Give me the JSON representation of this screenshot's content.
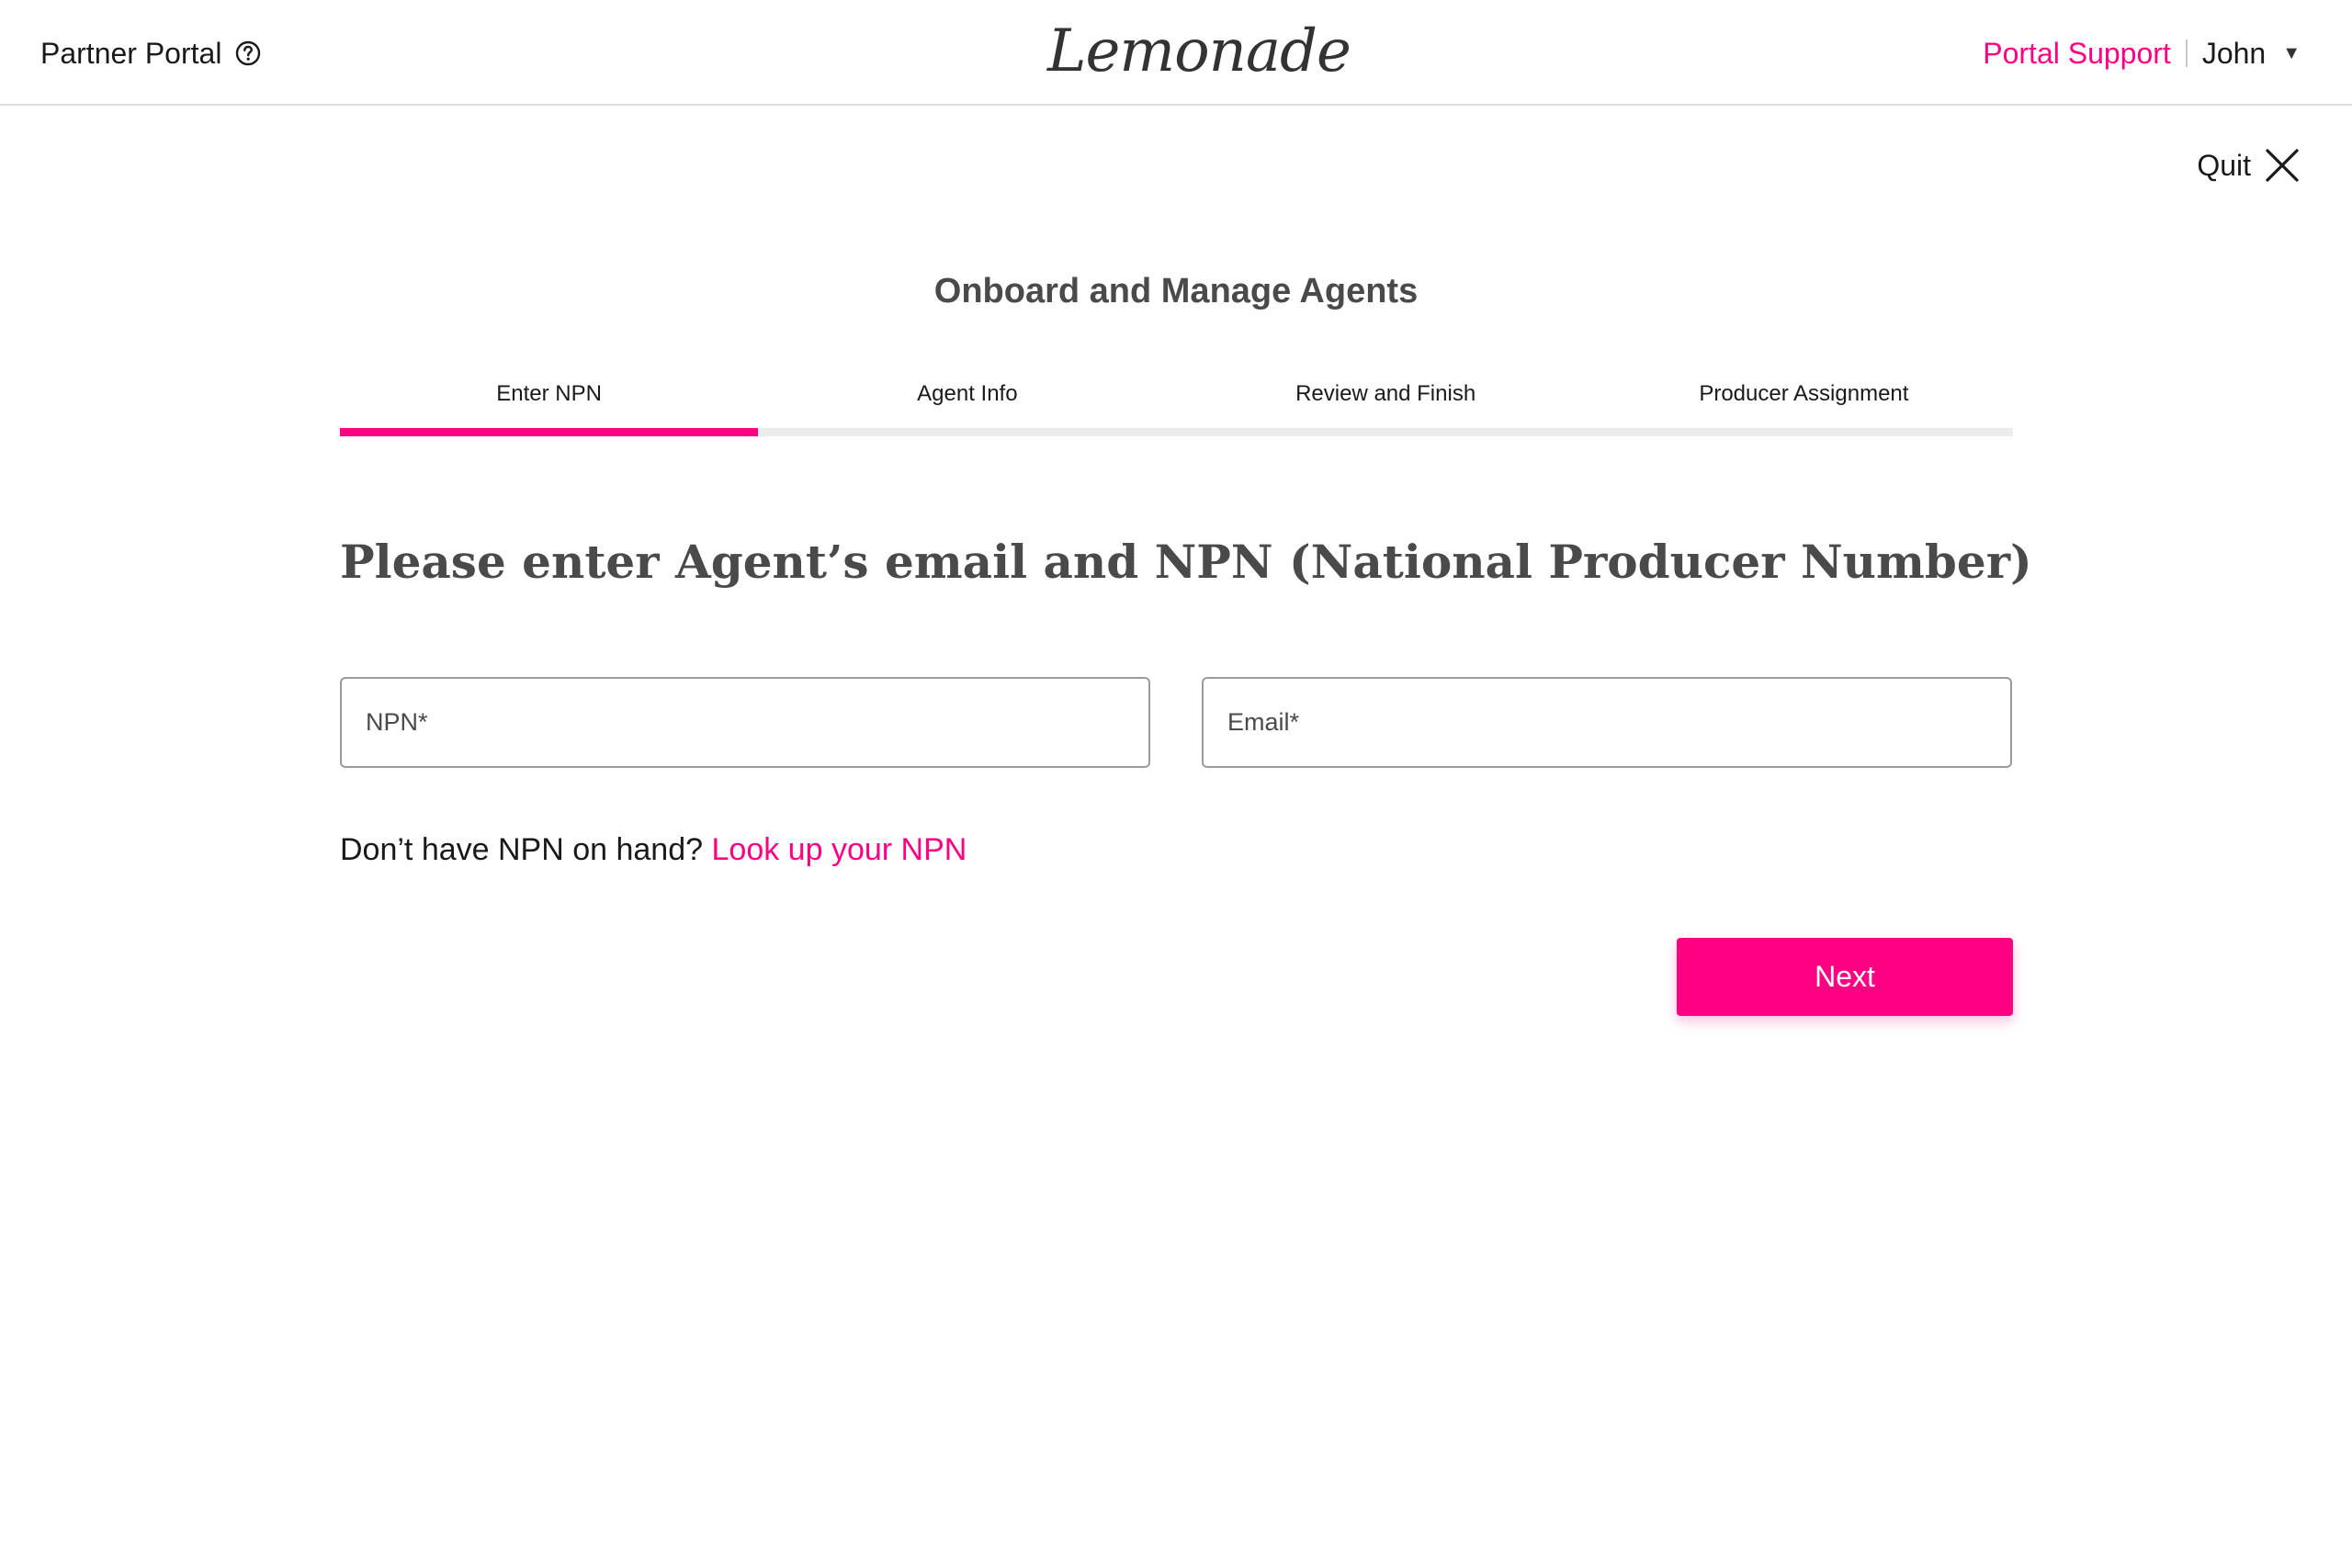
{
  "header": {
    "portal_title": "Partner Portal",
    "help_icon": "question-circle-icon",
    "logo_text": "Lemonade",
    "support_link": "Portal Support",
    "user_name": "John",
    "user_menu_icon": "caret-down-icon"
  },
  "quit": {
    "label": "Quit",
    "icon": "close-icon"
  },
  "wizard": {
    "title": "Onboard and Manage Agents",
    "steps": [
      {
        "label": "Enter NPN",
        "active": true
      },
      {
        "label": "Agent Info",
        "active": false
      },
      {
        "label": "Review and Finish",
        "active": false
      },
      {
        "label": "Producer Assignment",
        "active": false
      }
    ]
  },
  "form": {
    "heading": "Please enter Agent’s email and NPN (National Producer Number)",
    "npn": {
      "placeholder": "NPN*",
      "value": ""
    },
    "email": {
      "placeholder": "Email*",
      "value": ""
    },
    "help_text": "Don’t have NPN on hand?",
    "lookup_link": "Look up your NPN",
    "next_label": "Next"
  },
  "colors": {
    "accent": "#ff0083",
    "heading": "#4a4a4a",
    "track": "#ececec"
  }
}
